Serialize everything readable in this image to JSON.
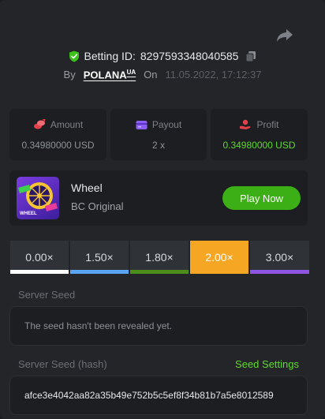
{
  "header": {
    "betting_id_label": "Betting ID:",
    "betting_id": "8297593348040585",
    "by_label": "By",
    "username": "POLANA",
    "username_badge": "UA",
    "on_label": "On",
    "date": "11.05.2022, 17:12:37"
  },
  "stats": {
    "amount": {
      "label": "Amount",
      "value": "0.34980000 USD"
    },
    "payout": {
      "label": "Payout",
      "value": "2 x"
    },
    "profit": {
      "label": "Profit",
      "value": "0.34980000 USD"
    }
  },
  "game": {
    "name": "Wheel",
    "subtitle": "BC Original",
    "thumb_label": "WHEEL",
    "play_label": "Play Now"
  },
  "multipliers": [
    {
      "label": "0.00×",
      "color": "#ffffff",
      "active": false
    },
    {
      "label": "1.50×",
      "color": "#5ba4f2",
      "active": false
    },
    {
      "label": "1.80×",
      "color": "#4b8e1b",
      "active": false
    },
    {
      "label": "2.00×",
      "color": "#f5a623",
      "active": true
    },
    {
      "label": "3.00×",
      "color": "#8d55e0",
      "active": false
    }
  ],
  "server_seed": {
    "label": "Server Seed",
    "value": "The seed hasn't been revealed yet."
  },
  "server_seed_hash": {
    "label": "Server Seed (hash)",
    "settings_link": "Seed Settings",
    "value": "afce3e4042aa82a35b49e752b5c5ef8f34b81b7a5e8012589"
  },
  "colors": {
    "accent_green": "#5edb2a",
    "play_button": "#3cae16",
    "active_tab": "#f5a623",
    "shield": "#3cc21a"
  },
  "icons": {
    "share": "share-arrow-icon",
    "shield": "shield-check-icon",
    "copy": "copy-icon",
    "amount": "coins-icon",
    "payout": "wallet-icon",
    "profit": "profit-hand-icon"
  }
}
